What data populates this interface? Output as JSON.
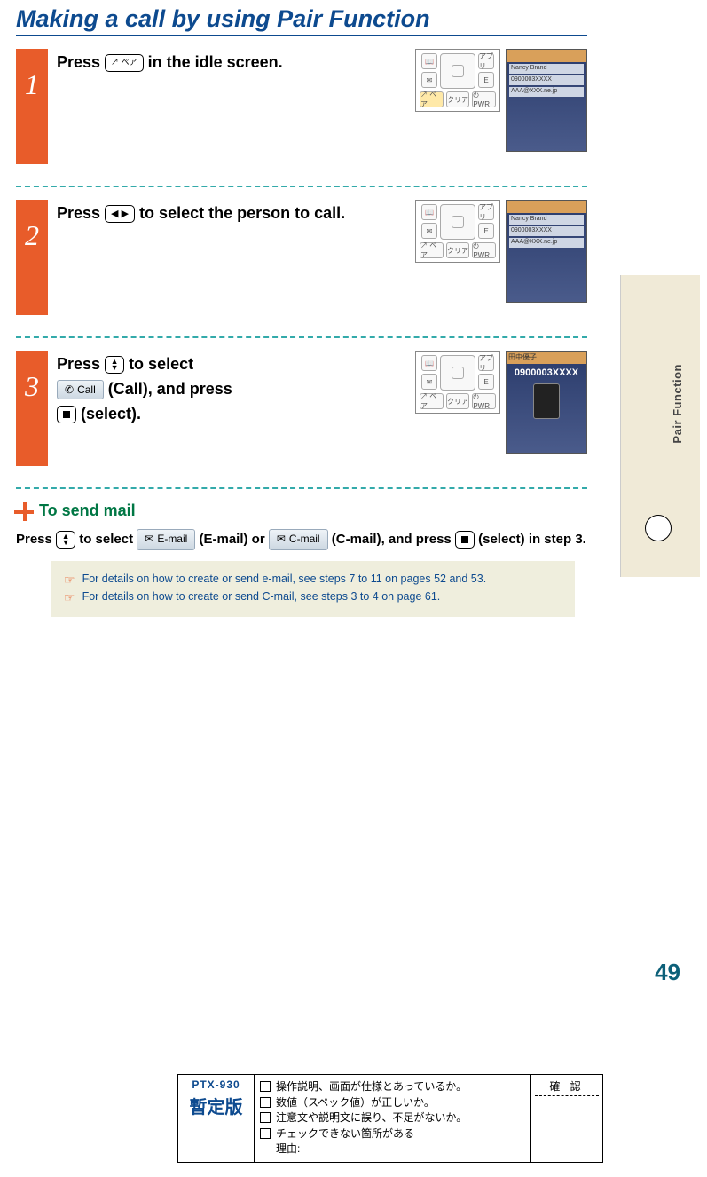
{
  "title": "Making a call by using Pair Function",
  "side_tab": "Pair Function",
  "page_number": "49",
  "steps": [
    {
      "num": "1",
      "text_before": "Press ",
      "key_label": "↗ ペア",
      "text_after": " in the idle screen."
    },
    {
      "num": "2",
      "text_before": "Press ",
      "key_label": "◀ ▶",
      "text_after": " to select the person to call."
    },
    {
      "num": "3",
      "line1_before": "Press ",
      "line1_key": "▲▼",
      "line1_after": " to select",
      "chip_label": "Call",
      "line2_mid": " (Call), and press ",
      "line3_key": "■",
      "line3_after": " (select)."
    }
  ],
  "keypad_labels": {
    "top_left": "📖",
    "top_right": "アプリ",
    "mid_left": "✉",
    "mid_right": "E",
    "bot_left": "↗ ペア",
    "bot_mid": "クリア",
    "bot_right": "⏻ PWR"
  },
  "screen_lines": {
    "name": "Nancy Brand",
    "num": "0900003XXXX",
    "addr": "AAA@XXX.ne.jp",
    "call_title": "田中優子",
    "call_num": "0900003XXXX"
  },
  "subhead": "To send mail",
  "mail_para": {
    "p1_before": "Press ",
    "p1_key1": "▲▼",
    "p1_mid1": " to select ",
    "chip_email": "E-mail",
    "p1_mid2": " (E-mail) or ",
    "chip_cmail": "C-mail",
    "p1_mid3": " (C-mail), and press ",
    "p1_key2": "■",
    "p1_after": " (select) in step 3."
  },
  "notes": [
    "For details on how to create or send e-mail, see steps 7 to 11 on pages 52 and 53.",
    "For details on how to create or send C-mail, see steps 3 to 4 on page 61."
  ],
  "checkbox": {
    "model": "PTX-930",
    "prov": "暫定版",
    "items": [
      "操作説明、画面が仕様とあっているか。",
      "数値（スペック値）が正しいか。",
      "注意文や説明文に誤り、不足がないか。",
      "チェックできない箇所がある"
    ],
    "reason_label": "理由:",
    "confirm": "確 認"
  }
}
